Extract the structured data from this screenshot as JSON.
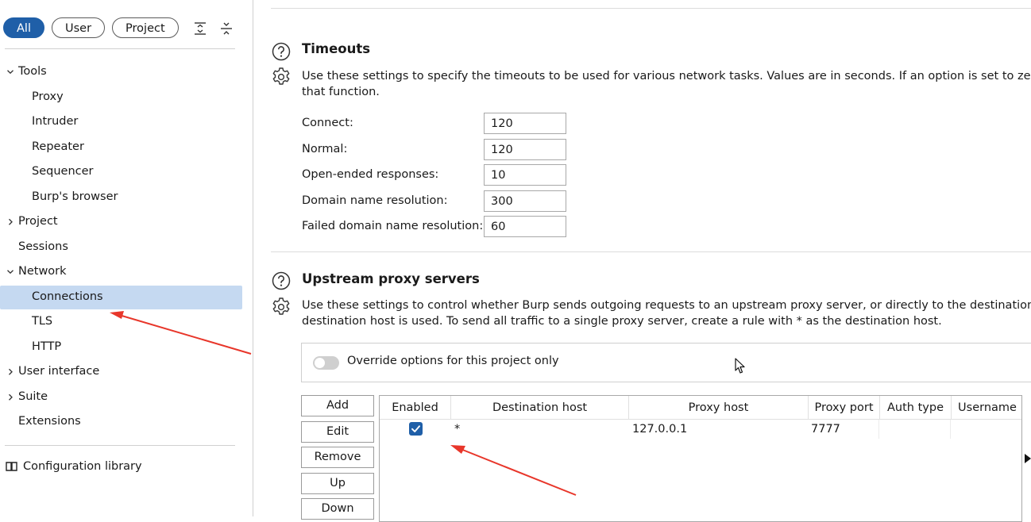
{
  "sidebar": {
    "filters": [
      "All",
      "User",
      "Project"
    ],
    "active_filter": "All",
    "tree": [
      {
        "label": "Tools",
        "level": 0,
        "chevron": "expanded"
      },
      {
        "label": "Proxy",
        "level": 1
      },
      {
        "label": "Intruder",
        "level": 1
      },
      {
        "label": "Repeater",
        "level": 1
      },
      {
        "label": "Sequencer",
        "level": 1
      },
      {
        "label": "Burp's browser",
        "level": 1
      },
      {
        "label": "Project",
        "level": 0,
        "chevron": "collapsed"
      },
      {
        "label": "Sessions",
        "level": 0
      },
      {
        "label": "Network",
        "level": 0,
        "chevron": "expanded"
      },
      {
        "label": "Connections",
        "level": 1,
        "selected": true
      },
      {
        "label": "TLS",
        "level": 1
      },
      {
        "label": "HTTP",
        "level": 1
      },
      {
        "label": "User interface",
        "level": 0,
        "chevron": "collapsed"
      },
      {
        "label": "Suite",
        "level": 0,
        "chevron": "collapsed"
      },
      {
        "label": "Extensions",
        "level": 0
      }
    ],
    "config_library": "Configuration library"
  },
  "timeouts": {
    "title": "Timeouts",
    "desc_line1": "Use these settings to specify the timeouts to be used for various network tasks. Values are in seconds. If an option is set to zero o",
    "desc_line2": "that function.",
    "fields": [
      {
        "label": "Connect:",
        "value": "120"
      },
      {
        "label": "Normal:",
        "value": "120"
      },
      {
        "label": "Open-ended responses:",
        "value": "10"
      },
      {
        "label": "Domain name resolution:",
        "value": "300"
      },
      {
        "label": "Failed domain name resolution:",
        "value": "60"
      }
    ]
  },
  "upstream": {
    "title": "Upstream proxy servers",
    "desc_line1": "Use these settings to  control whether Burp sends outgoing requests to an upstream proxy server, or directly to the destination w",
    "desc_line2": "destination host is used. To send all traffic to a single proxy server, create a rule with * as the destination host.",
    "override_label": "Override options for this project only",
    "buttons": [
      "Add",
      "Edit",
      "Remove",
      "Up",
      "Down"
    ],
    "columns": [
      "Enabled",
      "Destination host",
      "Proxy host",
      "Proxy port",
      "Auth type",
      "Username"
    ],
    "rows": [
      {
        "enabled": true,
        "destination_host": "*",
        "proxy_host": "127.0.0.1",
        "proxy_port": "7777",
        "auth_type": "",
        "username": ""
      }
    ]
  },
  "colors": {
    "accent": "#1f5fa8",
    "selection": "#c5d9f1",
    "annotation_arrow": "#e8362a"
  }
}
